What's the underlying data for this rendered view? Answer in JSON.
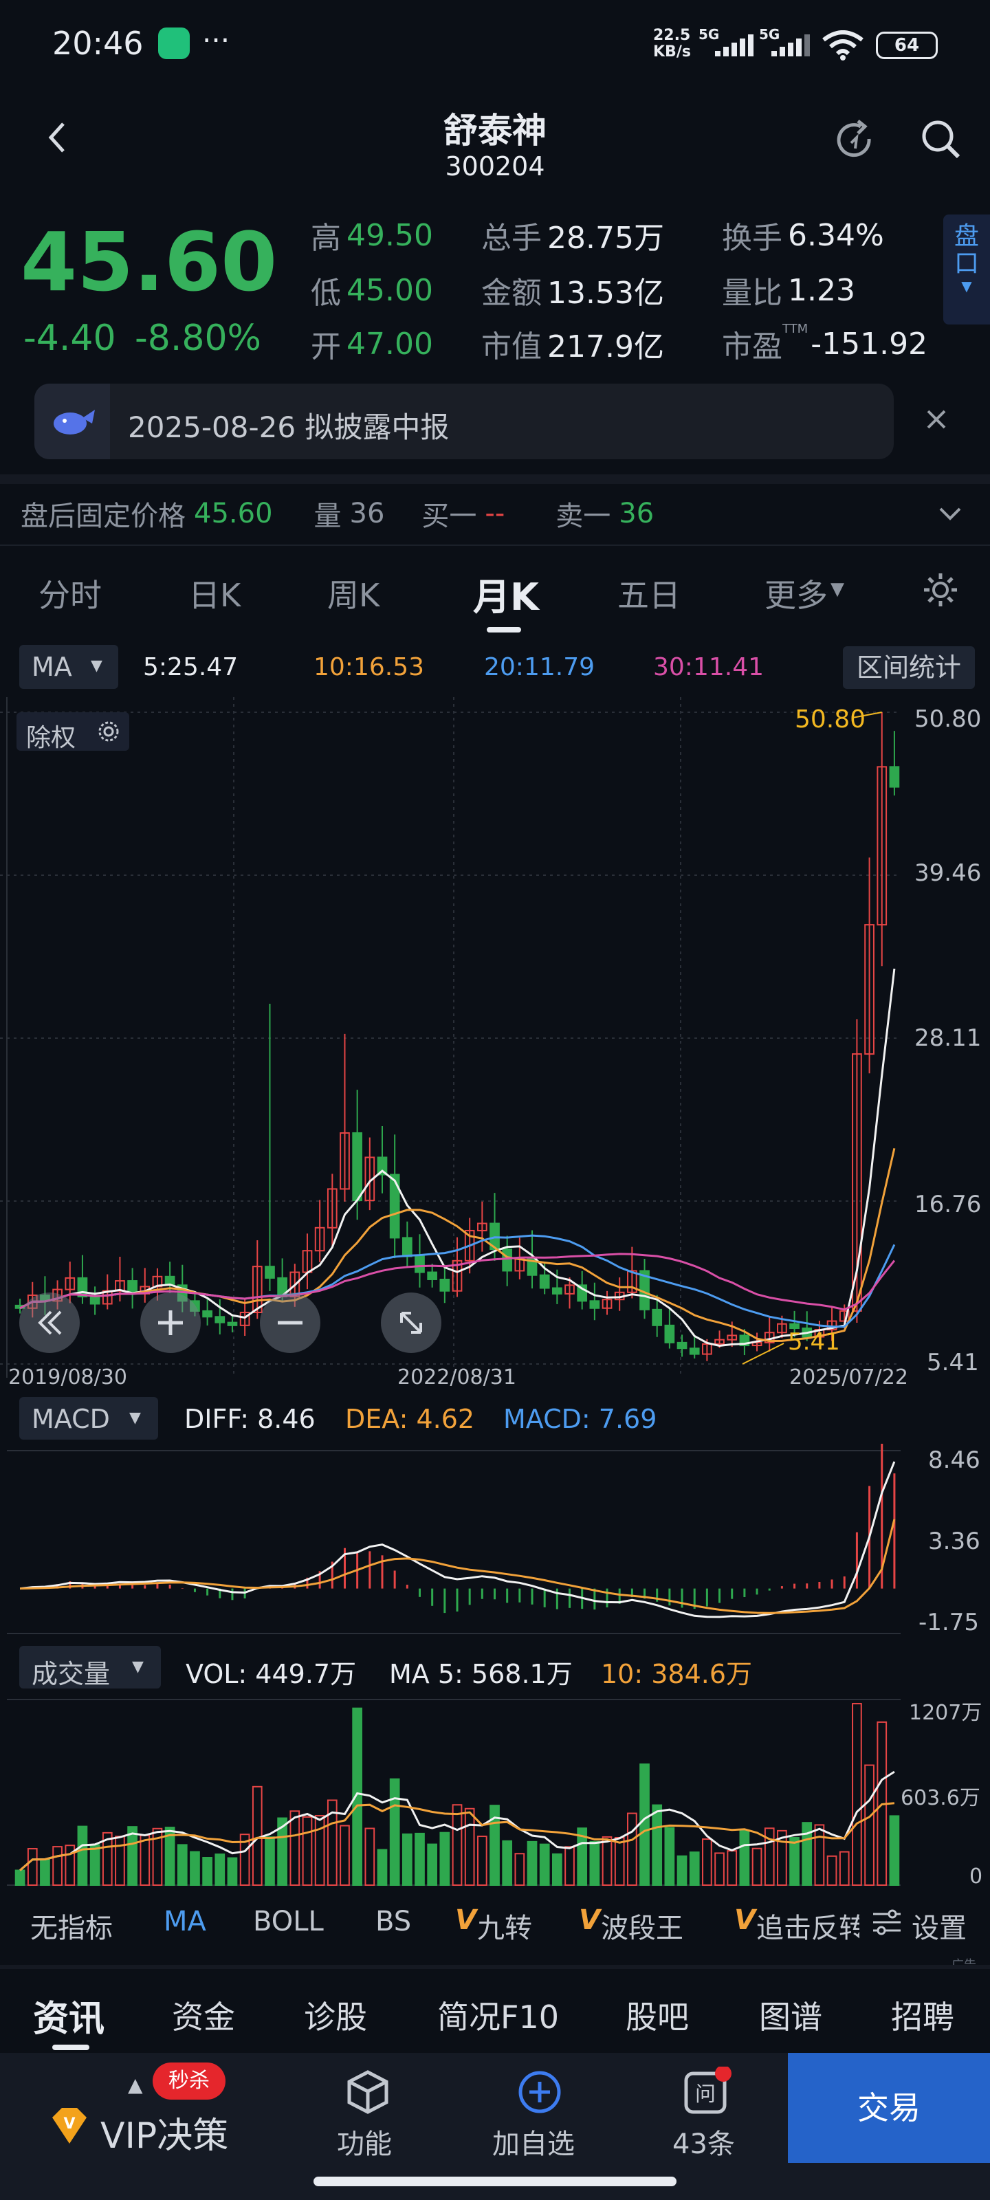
{
  "status_bar": {
    "time": "20:46",
    "speed_top": "22.5",
    "speed_bottom": "KB/s",
    "net1": "5G",
    "net2": "5G",
    "battery": "64"
  },
  "header": {
    "title": "舒泰神",
    "code": "300204"
  },
  "quote": {
    "price": "45.60",
    "change": "-4.40",
    "change_pct": "-8.80%",
    "high_label": "高",
    "high": "49.50",
    "low_label": "低",
    "low": "45.00",
    "open_label": "开",
    "open": "47.00",
    "vol_label": "总手",
    "vol": "28.75万",
    "amt_label": "金额",
    "amt": "13.53亿",
    "cap_label": "市值",
    "cap": "217.9亿",
    "turnover_label": "换手",
    "turnover": "6.34%",
    "ratio_label": "量比",
    "ratio": "1.23",
    "pe_label": "市盈",
    "pe_sup": "TTM",
    "pe": "-151.92",
    "side_tab": "盘口"
  },
  "notice": {
    "text": "2025-08-26 拟披露中报"
  },
  "after_hours": {
    "label": "盘后固定价格",
    "price": "45.60",
    "vol_label": "量",
    "vol": "36",
    "buy_label": "买一",
    "buy": "--",
    "sell_label": "卖一",
    "sell": "36"
  },
  "period_tabs": [
    "分时",
    "日K",
    "周K",
    "月K",
    "五日",
    "更多"
  ],
  "active_period": "月K",
  "ma_bar": {
    "select": "MA",
    "ma5": "5:25.47",
    "ma10": "10:16.53",
    "ma20": "20:11.79",
    "ma30": "30:11.41",
    "stats_btn": "区间统计"
  },
  "chart_controls": {
    "adjust_label": "除权"
  },
  "price_axis": [
    "50.80",
    "39.46",
    "28.11",
    "16.76",
    "5.41"
  ],
  "date_axis": [
    "2019/08/30",
    "2022/08/31",
    "2025/07/22"
  ],
  "max_marker": "50.80",
  "min_marker": "5.41",
  "macd_bar": {
    "select": "MACD",
    "diff": "DIFF: 8.46",
    "dea": "DEA: 4.62",
    "macd": "MACD: 7.69"
  },
  "macd_axis": [
    "8.46",
    "3.36",
    "-1.75"
  ],
  "vol_bar": {
    "select": "成交量",
    "vol": "VOL: 449.7万",
    "ma5": "MA 5: 568.1万",
    "ma10": "10: 384.6万"
  },
  "vol_axis": [
    "1207万",
    "603.6万",
    "0"
  ],
  "indicator_tabs": [
    "无指标",
    "MA",
    "BOLL",
    "BS",
    "九转",
    "波段王",
    "追击反转"
  ],
  "indicator_settings": "设置",
  "ad_tag": "广告",
  "info_tabs": [
    "资讯",
    "资金",
    "诊股",
    "简况F10",
    "股吧",
    "图谱",
    "招聘"
  ],
  "bottom_nav": {
    "vip_badge": "秒杀",
    "vip": "VIP决策",
    "func": "功能",
    "add": "加自选",
    "msgs": "43条",
    "trade": "交易"
  },
  "colors": {
    "up": "#e64545",
    "down": "#2ea84e",
    "ma5": "#f2f2f2",
    "ma10": "#f2a23a",
    "ma20": "#4d9cf0",
    "ma30": "#d94fa7",
    "accent": "#2563c9"
  },
  "chart_data": {
    "type": "candlestick",
    "period": "monthly",
    "x_range": [
      "2019/08/30",
      "2025/07/22"
    ],
    "y_range": [
      5.41,
      50.8
    ],
    "y_ticks": [
      50.8,
      39.46,
      28.11,
      16.76,
      5.41
    ],
    "last_candle": {
      "open": 47.0,
      "high": 49.5,
      "low": 45.0,
      "close": 45.6
    },
    "ma": {
      "MA5": 25.47,
      "MA10": 16.53,
      "MA20": 11.79,
      "MA30": 11.41
    },
    "closes": [
      9.3,
      10.2,
      9.8,
      10.6,
      11.4,
      10.1,
      9.6,
      10.5,
      11.2,
      10.3,
      10.8,
      11.5,
      10.9,
      9.8,
      9.1,
      8.7,
      8.3,
      8.1,
      9.0,
      12.2,
      11.4,
      10.1,
      11.8,
      13.3,
      14.9,
      17.6,
      21.5,
      16.8,
      19.8,
      18.6,
      14.2,
      12.9,
      11.8,
      11.3,
      10.5,
      12.6,
      14.7,
      15.2,
      13.4,
      11.9,
      12.8,
      11.6,
      10.7,
      10.3,
      10.9,
      9.8,
      9.3,
      9.9,
      10.4,
      11.9,
      9.2,
      8.1,
      6.9,
      6.5,
      6.1,
      6.8,
      7.1,
      7.4,
      6.7,
      6.9,
      7.6,
      8.2,
      7.9,
      7.3,
      7.8,
      8.4,
      9.1,
      27.0,
      36.0,
      47.0,
      45.6
    ],
    "macd": {
      "DIFF": 8.46,
      "DEA": 4.62,
      "MACD": 7.69,
      "y_ticks": [
        8.46,
        3.36,
        -1.75
      ]
    },
    "volume": {
      "VOL_wan": 449.7,
      "MA5_wan": 568.1,
      "MA10_wan": 384.6,
      "y_ticks": [
        "1207万",
        "603.6万",
        "0"
      ]
    }
  }
}
